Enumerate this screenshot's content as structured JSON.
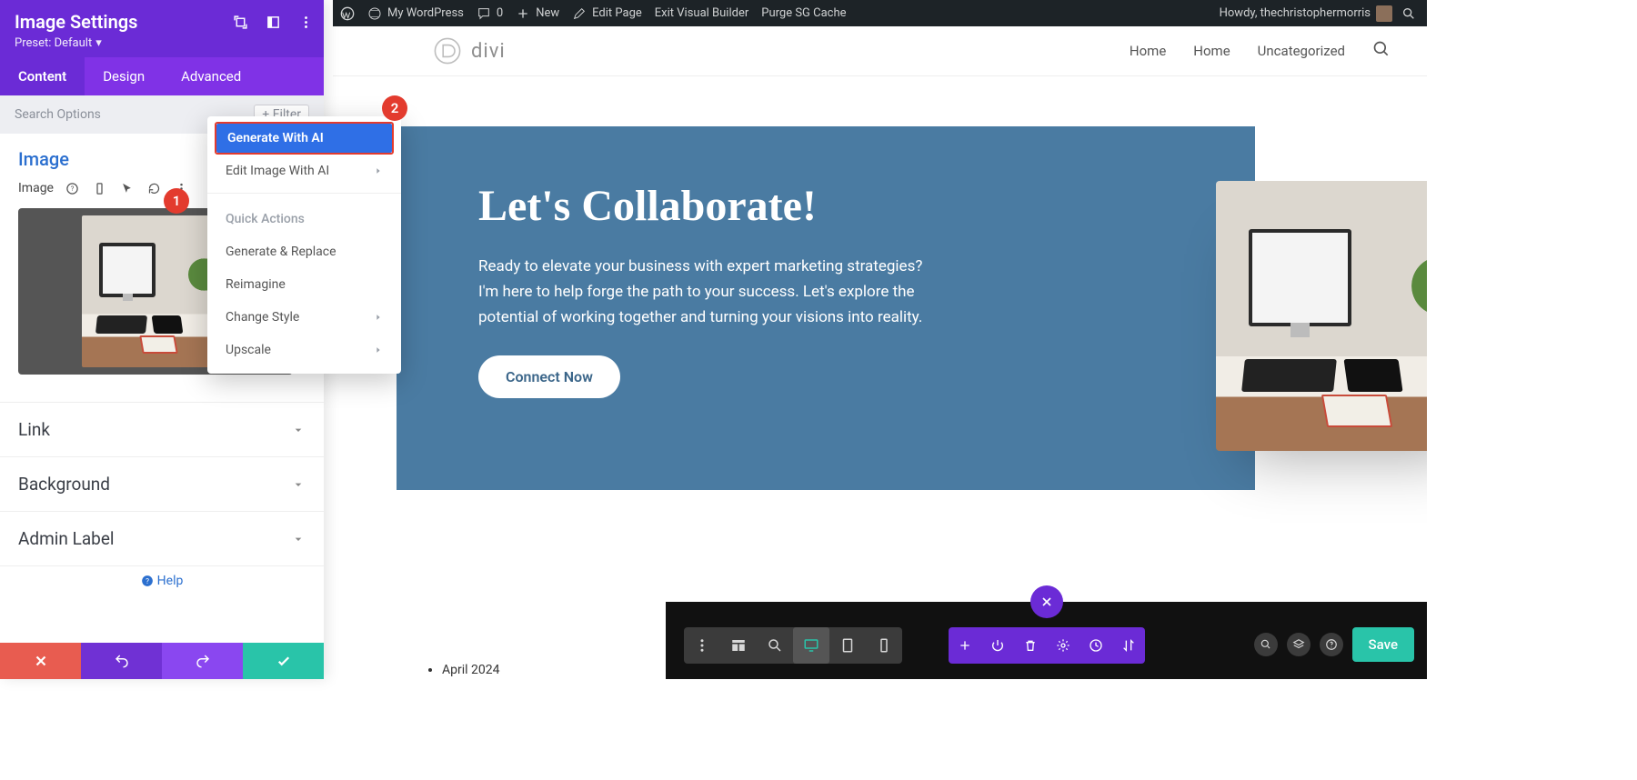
{
  "wp_bar": {
    "site": "My WordPress",
    "comments": "0",
    "new": "New",
    "edit_page": "Edit Page",
    "exit_vb": "Exit Visual Builder",
    "purge": "Purge SG Cache",
    "howdy": "Howdy, thechristophermorris"
  },
  "site_header": {
    "logo_text": "divi",
    "nav": [
      "Home",
      "Home",
      "Uncategorized"
    ]
  },
  "hero": {
    "title": "Let's Collaborate!",
    "text": "Ready to elevate your business with expert marketing strategies? I'm here to help forge the path to your success. Let's explore the potential of working together and turning your visions into reality.",
    "cta": "Connect Now"
  },
  "list_fragment": "April 2024",
  "bottom_bar": {
    "save": "Save"
  },
  "panel": {
    "title": "Image Settings",
    "preset": "Preset: Default",
    "tabs": [
      "Content",
      "Design",
      "Advanced"
    ],
    "search_placeholder": "Search Options",
    "filter": "Filter",
    "group_title": "Image",
    "sub_label": "Image",
    "accordion": [
      "Link",
      "Background",
      "Admin Label"
    ],
    "help": "Help"
  },
  "ai_menu": {
    "generate": "Generate With AI",
    "edit": "Edit Image With AI",
    "quick_heading": "Quick Actions",
    "items": [
      "Generate & Replace",
      "Reimagine",
      "Change Style",
      "Upscale"
    ]
  },
  "badges": {
    "one": "1",
    "two": "2"
  }
}
